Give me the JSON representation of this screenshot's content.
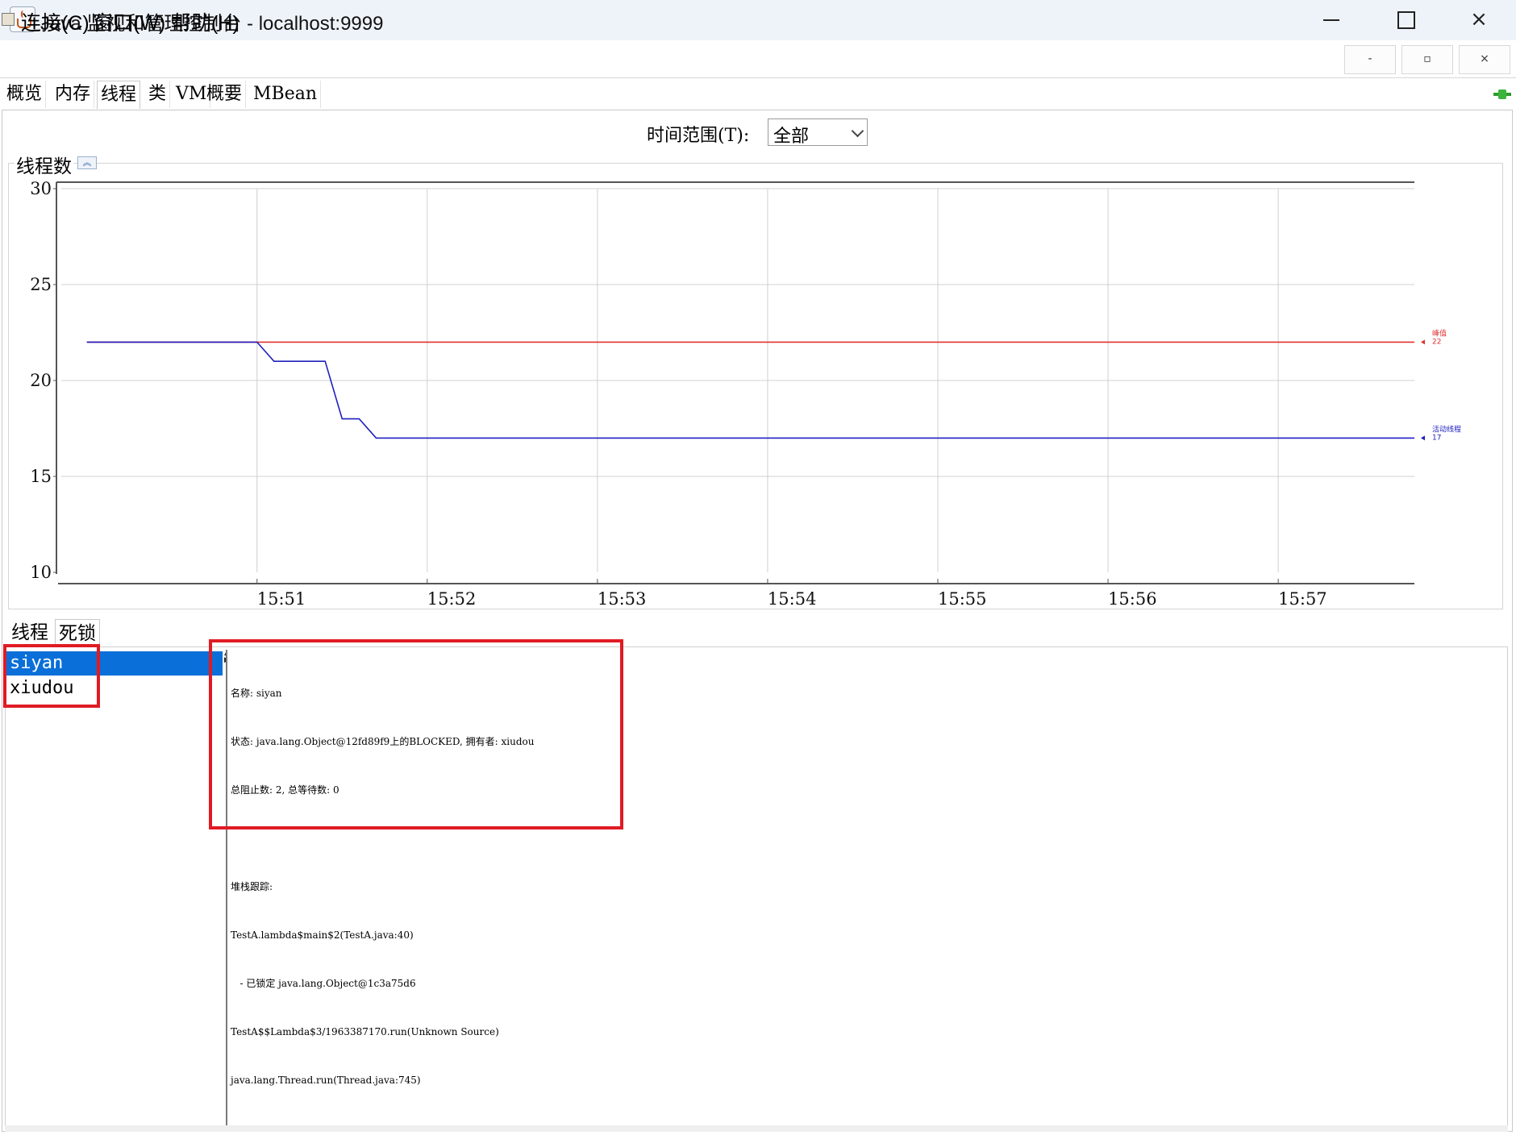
{
  "window": {
    "title": "Java 监视和管理控制台 - localhost:9999",
    "controls": {
      "minimize": "–",
      "maximize": "□",
      "close": "×"
    }
  },
  "menu": {
    "items": [
      "连接(C)",
      "窗口(W)",
      "帮助(H)"
    ],
    "mdi_controls": [
      "-",
      "▫",
      "×"
    ]
  },
  "tabs": {
    "items": [
      "概览",
      "内存",
      "线程",
      "类",
      "VM",
      "概要",
      "MBean"
    ],
    "selected": "线程"
  },
  "time_range": {
    "label": "时间范围(T):",
    "value": "全部"
  },
  "chart": {
    "panel_title": "线程数",
    "collapse_icon": "double-chevron-up-icon"
  },
  "chart_data": {
    "type": "line",
    "title": "",
    "xlabel": "",
    "ylabel": "",
    "ylim": [
      10,
      30
    ],
    "yticks": [
      10,
      15,
      20,
      25,
      30
    ],
    "xticks": [
      "15:51",
      "15:52",
      "15:53",
      "15:54",
      "15:55",
      "15:56",
      "15:57"
    ],
    "x_unit_minutes": true,
    "grid": true,
    "series": [
      {
        "name": "峰值",
        "color": "#e03030",
        "end_label": "22",
        "points": [
          [
            "15:50.0",
            22
          ],
          [
            "15:57.8",
            22
          ]
        ]
      },
      {
        "name": "活动线程",
        "color": "#2020c0",
        "end_label": "17",
        "points": [
          [
            "15:50.0",
            22
          ],
          [
            "15:51.0",
            22
          ],
          [
            "15:51.1",
            21
          ],
          [
            "15:51.4",
            21
          ],
          [
            "15:51.5",
            18
          ],
          [
            "15:51.6",
            18
          ],
          [
            "15:51.7",
            17
          ],
          [
            "15:57.8",
            17
          ]
        ]
      }
    ]
  },
  "bottom_tabs": {
    "items": [
      "线程",
      "死锁"
    ],
    "selected": "死锁"
  },
  "thread_list": {
    "items": [
      "siyan",
      "xiudou"
    ],
    "selected": "siyan"
  },
  "thread_detail": {
    "lines": [
      "名称: siyan",
      "状态: java.lang.Object@12fd89f9上的BLOCKED, 拥有者: xiudou",
      "总阻止数: 2, 总等待数: 0",
      "",
      "堆栈跟踪:",
      "TestA.lambda$main$2(TestA.java:40)",
      "   - 已锁定 java.lang.Object@1c3a75d6",
      "TestA$$Lambda$3/1963387170.run(Unknown Source)",
      "java.lang.Thread.run(Thread.java:745)"
    ]
  },
  "colors": {
    "selection": "#0a6fd8",
    "highlight": "#e01b24",
    "peak_line": "#e03030",
    "live_line": "#2020c0"
  }
}
